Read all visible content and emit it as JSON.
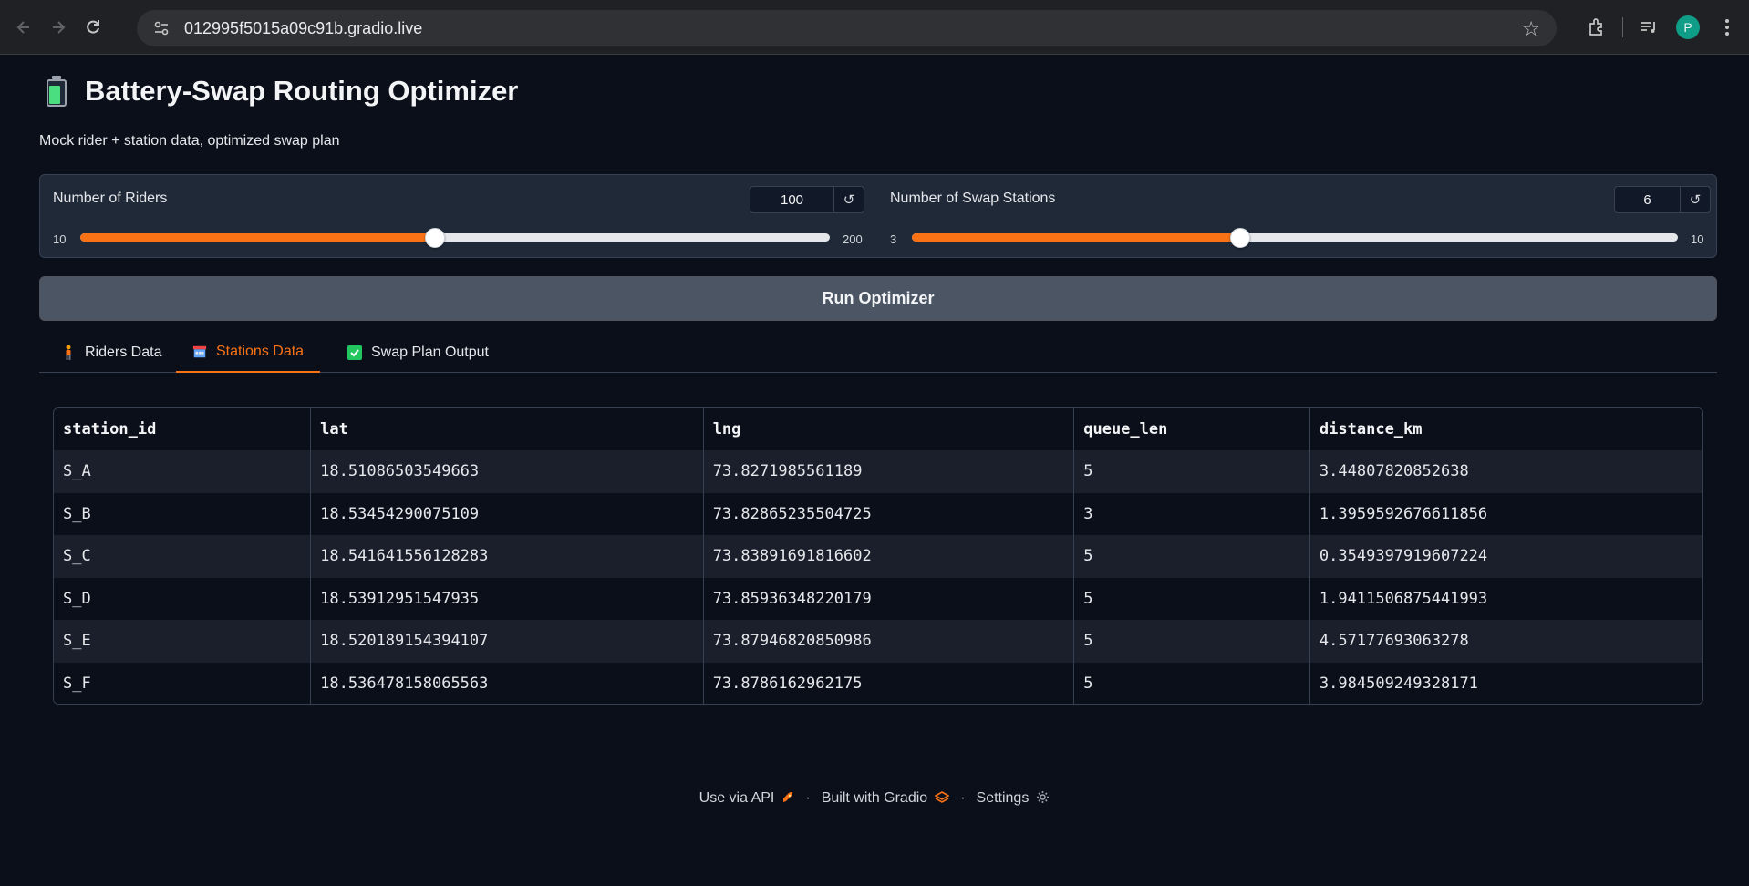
{
  "browser": {
    "url": "012995f5015a09c91b.gradio.live",
    "profile_initial": "P",
    "icons": [
      "back-icon",
      "forward-icon",
      "reload-icon",
      "site-info-icon",
      "bookmark-star-icon",
      "extensions-icon",
      "media-icon",
      "menu-icon"
    ]
  },
  "app": {
    "title": "Battery-Swap Routing Optimizer",
    "subtitle": "Mock rider + station data, optimized swap plan"
  },
  "sliders": {
    "riders": {
      "label": "Number of Riders",
      "value": "100",
      "min": "10",
      "max": "200",
      "fraction": 0.4737
    },
    "stations": {
      "label": "Number of Swap Stations",
      "value": "6",
      "min": "3",
      "max": "10",
      "fraction": 0.4286
    }
  },
  "run_button": {
    "label": "Run Optimizer"
  },
  "tabs": [
    {
      "label": "Riders Data",
      "icon": "rider-icon",
      "active": false
    },
    {
      "label": "Stations Data",
      "icon": "station-icon",
      "active": true
    },
    {
      "label": "Swap Plan Output",
      "icon": "checkbox-icon",
      "active": false
    }
  ],
  "table": {
    "columns": [
      "station_id",
      "lat",
      "lng",
      "queue_len",
      "distance_km"
    ],
    "rows": [
      [
        "S_A",
        "18.51086503549663",
        "73.8271985561189",
        "5",
        "3.44807820852638"
      ],
      [
        "S_B",
        "18.53454290075109",
        "73.82865235504725",
        "3",
        "1.3959592676611856"
      ],
      [
        "S_C",
        "18.541641556128283",
        "73.83891691816602",
        "5",
        "0.3549397919607224"
      ],
      [
        "S_D",
        "18.53912951547935",
        "73.85936348220179",
        "5",
        "1.9411506875441993"
      ],
      [
        "S_E",
        "18.520189154394107",
        "73.87946820850986",
        "5",
        "4.57177693063278"
      ],
      [
        "S_F",
        "18.536478158065563",
        "73.8786162962175",
        "5",
        "3.984509249328171"
      ]
    ]
  },
  "footer": {
    "api": "Use via API",
    "built": "Built with Gradio",
    "settings": "Settings",
    "separator": "·"
  },
  "colors": {
    "accent": "#f97316",
    "background": "#0b0f19",
    "panel": "#1f2937",
    "button": "#4b5563"
  }
}
